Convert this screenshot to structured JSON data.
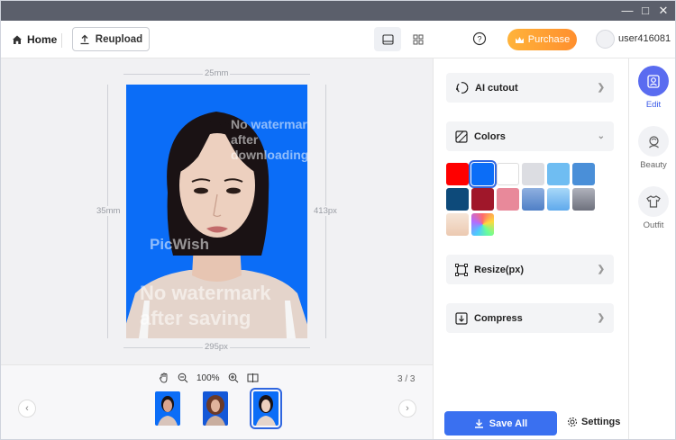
{
  "toolbar": {
    "home_label": "Home",
    "reupload_label": "Reupload",
    "purchase_label": "Purchase",
    "username": "user416081"
  },
  "canvas": {
    "width_mm": "25mm",
    "height_mm": "35mm",
    "width_px": "295px",
    "height_px": "413px",
    "watermark_top": "No watermark after downloading",
    "watermark_mid": "PicWish",
    "watermark_main": "No watermark after saving"
  },
  "strip": {
    "zoom": "100%",
    "counter": "3 / 3",
    "thumbnails": [
      "thumb-1",
      "thumb-2",
      "thumb-3"
    ],
    "selected_thumbnail": 3
  },
  "panel": {
    "ai_cutout": "AI cutout",
    "colors": "Colors",
    "resize": "Resize(px)",
    "compress": "Compress",
    "save_all": "Save All",
    "settings": "Settings",
    "swatches": [
      "#ff0000",
      "#0b6df7",
      "#ffffff",
      "#dcdde2",
      "#6fbdf2",
      "#4a8fd8",
      "#0d4a7a",
      "#a0172a",
      "#e8899a",
      "#6b93d0",
      "#76b9ef",
      "#8c8f9c",
      "#f1d6c2",
      "gradient"
    ]
  },
  "rnav": {
    "items": [
      {
        "label": "Edit",
        "icon": "portrait-icon"
      },
      {
        "label": "Beauty",
        "icon": "face-icon"
      },
      {
        "label": "Outfit",
        "icon": "shirt-icon"
      }
    ]
  },
  "colors": {
    "accent": "#3a70f0",
    "photo_background": "#0b6df7",
    "purchase": "#ff9f34"
  }
}
